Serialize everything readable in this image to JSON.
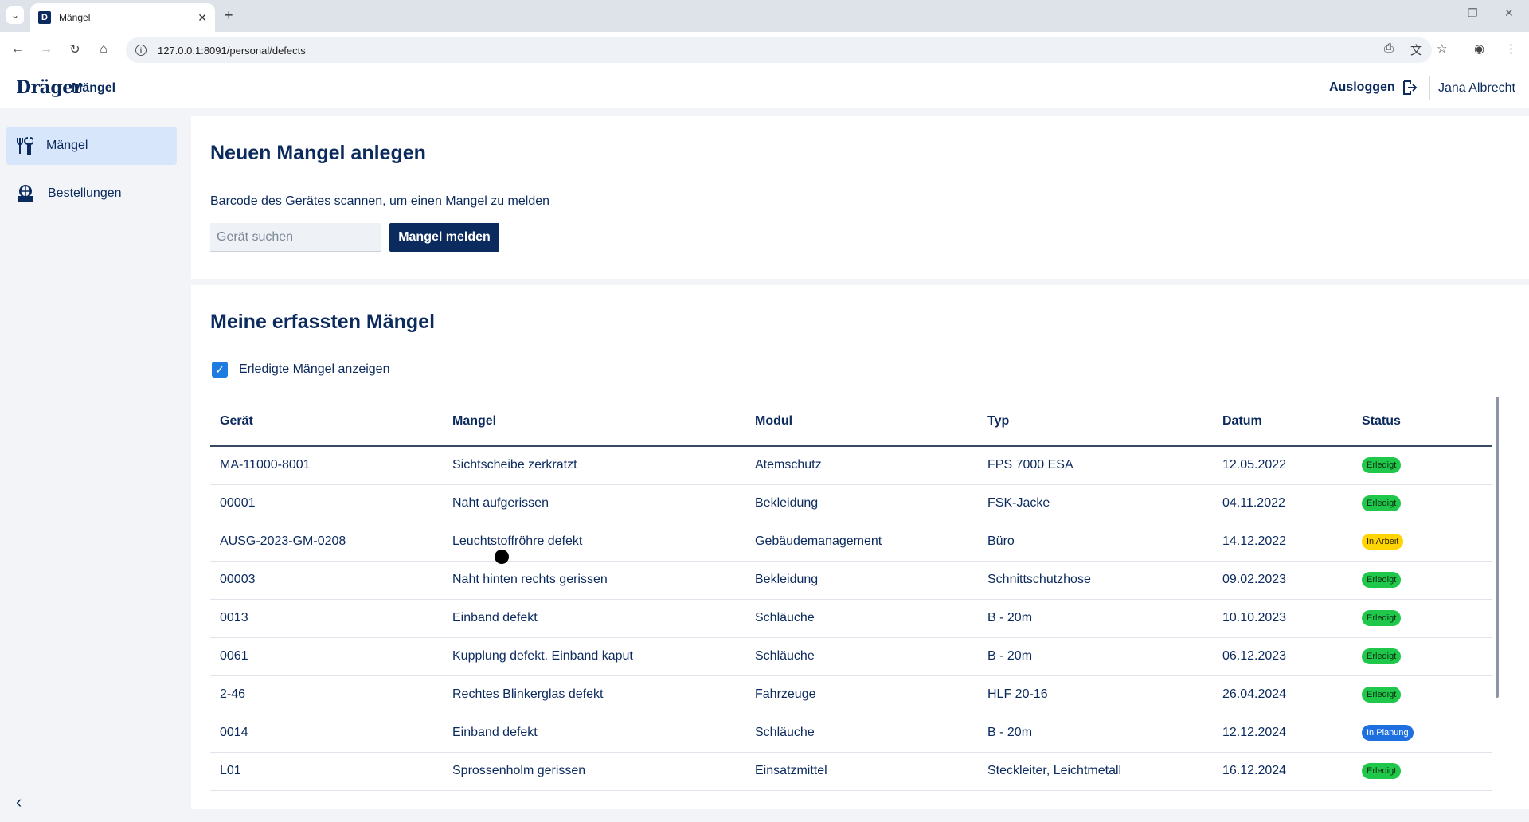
{
  "browser": {
    "tab_title": "Mängel",
    "favicon_letter": "D",
    "url": "127.0.0.1:8091/personal/defects"
  },
  "header": {
    "logo": "Dräger",
    "title": "Mängel",
    "logout_label": "Ausloggen",
    "user_name": "Jana Albrecht"
  },
  "sidebar": {
    "items": [
      {
        "label": "Mängel",
        "icon": "tools-icon",
        "active": true
      },
      {
        "label": "Bestellungen",
        "icon": "globe-box-icon",
        "active": false
      }
    ]
  },
  "create": {
    "title": "Neuen Mangel anlegen",
    "description": "Barcode des Gerätes scannen, um einen Mangel zu melden",
    "search_placeholder": "Gerät suchen",
    "button_label": "Mangel melden"
  },
  "defects": {
    "title": "Meine erfassten Mängel",
    "checkbox_label": "Erledigte Mängel anzeigen",
    "checkbox_checked": true,
    "columns": [
      "Gerät",
      "Mangel",
      "Modul",
      "Typ",
      "Datum",
      "Status"
    ],
    "rows": [
      {
        "geraet": "MA-11000-8001",
        "mangel": "Sichtscheibe zerkratzt",
        "modul": "Atemschutz",
        "typ": "FPS 7000 ESA",
        "datum": "12.05.2022",
        "status": "Erledigt",
        "status_type": "done"
      },
      {
        "geraet": "00001",
        "mangel": "Naht aufgerissen",
        "modul": "Bekleidung",
        "typ": "FSK-Jacke",
        "datum": "04.11.2022",
        "status": "Erledigt",
        "status_type": "done"
      },
      {
        "geraet": "AUSG-2023-GM-0208",
        "mangel": "Leuchtstoffröhre defekt",
        "modul": "Gebäudemanagement",
        "typ": "Büro",
        "datum": "14.12.2022",
        "status": "In Arbeit",
        "status_type": "work"
      },
      {
        "geraet": "00003",
        "mangel": "Naht hinten rechts gerissen",
        "modul": "Bekleidung",
        "typ": "Schnittschutzhose",
        "datum": "09.02.2023",
        "status": "Erledigt",
        "status_type": "done"
      },
      {
        "geraet": "0013",
        "mangel": "Einband defekt",
        "modul": "Schläuche",
        "typ": "B - 20m",
        "datum": "10.10.2023",
        "status": "Erledigt",
        "status_type": "done"
      },
      {
        "geraet": "0061",
        "mangel": "Kupplung defekt. Einband kaput",
        "modul": "Schläuche",
        "typ": "B - 20m",
        "datum": "06.12.2023",
        "status": "Erledigt",
        "status_type": "done"
      },
      {
        "geraet": "2-46",
        "mangel": "Rechtes Blinkerglas defekt",
        "modul": "Fahrzeuge",
        "typ": "HLF 20-16",
        "datum": "26.04.2024",
        "status": "Erledigt",
        "status_type": "done"
      },
      {
        "geraet": "0014",
        "mangel": "Einband defekt",
        "modul": "Schläuche",
        "typ": "B - 20m",
        "datum": "12.12.2024",
        "status": "In Planung",
        "status_type": "plan"
      },
      {
        "geraet": "L01",
        "mangel": "Sprossenholm gerissen",
        "modul": "Einsatzmittel",
        "typ": "Steckleiter, Leichtmetall",
        "datum": "16.12.2024",
        "status": "Erledigt",
        "status_type": "done"
      }
    ]
  }
}
